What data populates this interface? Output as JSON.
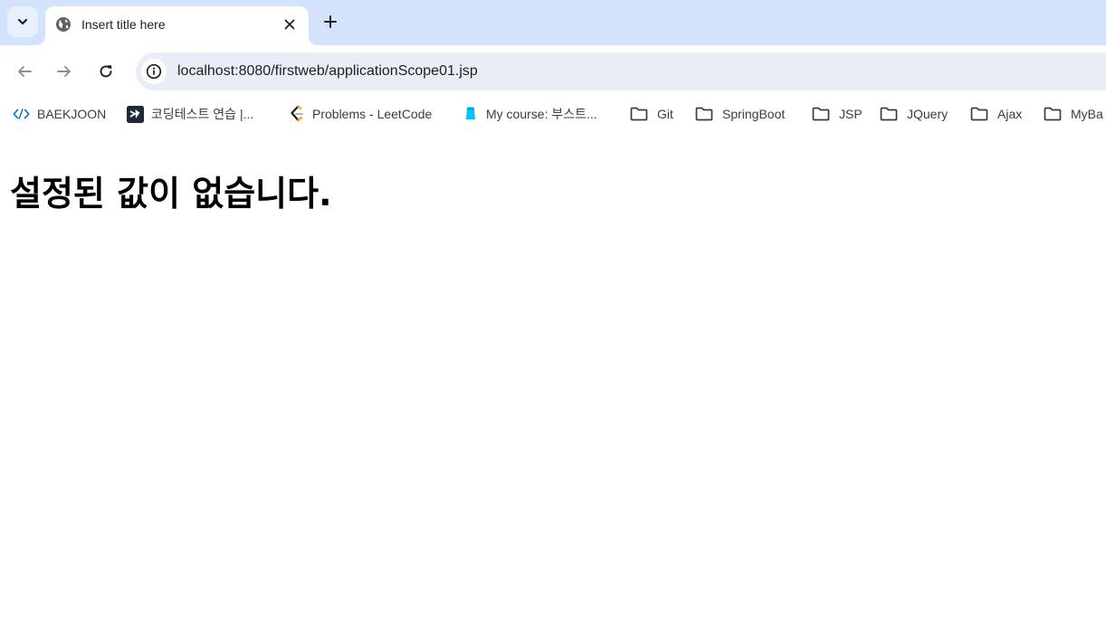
{
  "colors": {
    "tabstrip_bg": "#d3e3fd",
    "omnibox_bg": "#e9eef6",
    "icon_gray": "#474747",
    "baekjoon_blue": "#0076c0",
    "programmers_navy": "#1e2a3c",
    "leetcode_orange": "#ffa116",
    "boostcourse_cyan": "#00c3ff"
  },
  "tab": {
    "title": "Insert title here",
    "favicon": "globe-icon"
  },
  "address_bar": {
    "url": "localhost:8080/firstweb/applicationScope01.jsp"
  },
  "bookmarks": [
    {
      "label": "BAEKJOON",
      "icon": "baekjoon-code-icon"
    },
    {
      "label": "코딩테스트 연습 |...",
      "icon": "programmers-icon"
    },
    {
      "label": "Problems - LeetCode",
      "icon": "leetcode-icon"
    },
    {
      "label": "My course: 부스트...",
      "icon": "boostcourse-icon"
    },
    {
      "label": "Git",
      "icon": "folder-icon"
    },
    {
      "label": "SpringBoot",
      "icon": "folder-icon"
    },
    {
      "label": "JSP",
      "icon": "folder-icon"
    },
    {
      "label": "JQuery",
      "icon": "folder-icon"
    },
    {
      "label": "Ajax",
      "icon": "folder-icon"
    },
    {
      "label": "MyBa",
      "icon": "folder-icon"
    }
  ],
  "page": {
    "heading": "설정된 값이 없습니다."
  }
}
